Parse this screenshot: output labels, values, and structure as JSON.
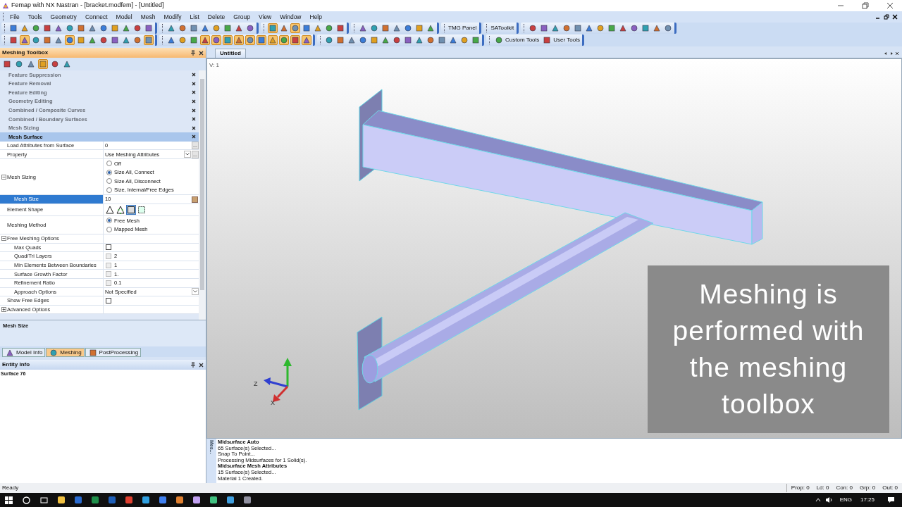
{
  "window": {
    "title": "Femap with NX Nastran - [bracket.modfem] - [Untitled]"
  },
  "menu": [
    "File",
    "Tools",
    "Geometry",
    "Connect",
    "Model",
    "Mesh",
    "Modify",
    "List",
    "Delete",
    "Group",
    "View",
    "Window",
    "Help"
  ],
  "toolbars": {
    "row_1_buttons": [
      "TMG Panel",
      "SAToolkit"
    ],
    "row_2_buttons": [
      "Custom Tools",
      "User Tools"
    ]
  },
  "toolbox": {
    "title": "Meshing Toolbox",
    "sections": [
      {
        "label": "Feature Suppression",
        "selected": false
      },
      {
        "label": "Feature Removal",
        "selected": false
      },
      {
        "label": "Feature Editing",
        "selected": false
      },
      {
        "label": "Geometry Editing",
        "selected": false
      },
      {
        "label": "Combined / Composite Curves",
        "selected": false
      },
      {
        "label": "Combined / Boundary Surfaces",
        "selected": false
      },
      {
        "label": "Mesh Sizing",
        "selected": false
      },
      {
        "label": "Mesh Surface",
        "selected": true
      }
    ],
    "properties": [
      {
        "kind": "field",
        "label": "Load Attributes from Surface",
        "value": "0",
        "dropdown": false,
        "button": "...",
        "selected": false
      },
      {
        "kind": "field",
        "label": "Property",
        "value": "Use Meshing Attributes",
        "dropdown": true,
        "button": "...",
        "selected": false
      },
      {
        "kind": "radio",
        "label": "Mesh Sizing",
        "expanded": true,
        "options": [
          {
            "label": "Off",
            "selected": false
          },
          {
            "label": "Size All, Connect",
            "selected": true
          },
          {
            "label": "Size All, Disconnect",
            "selected": false
          },
          {
            "label": "Size, Internal/Free Edges",
            "selected": false
          }
        ],
        "children": [
          {
            "kind": "field",
            "label": "Mesh Size",
            "value": "10",
            "dropdown": false,
            "selected": true
          }
        ]
      },
      {
        "kind": "shapes",
        "label": "Element Shape",
        "shapes": [
          {
            "kind": "tri",
            "selected": false
          },
          {
            "kind": "tri6",
            "selected": false
          },
          {
            "kind": "quad",
            "selected": true
          },
          {
            "kind": "quad8",
            "selected": false
          }
        ]
      },
      {
        "kind": "radio",
        "label": "Meshing Method",
        "options": [
          {
            "label": "Free Mesh",
            "selected": true
          },
          {
            "label": "Mapped Mesh",
            "selected": false
          }
        ]
      },
      {
        "kind": "group",
        "label": "Free Meshing Options",
        "expanded": true,
        "children": [
          {
            "kind": "checkbox",
            "label": "Max Quads",
            "checked": false
          },
          {
            "kind": "checkbox",
            "label": "Quad/Tri Layers",
            "checked": false,
            "value": "2"
          },
          {
            "kind": "checkbox",
            "label": "Min Elements Between Boundaries",
            "checked": false,
            "value": "1"
          },
          {
            "kind": "checkbox",
            "label": "Surface Growth Factor",
            "checked": false,
            "value": "1."
          },
          {
            "kind": "checkbox",
            "label": "Refinement Ratio",
            "checked": false,
            "value": "0.1"
          },
          {
            "kind": "field",
            "label": "Approach Options",
            "value": "Not Specified",
            "dropdown": true,
            "selected": false
          }
        ]
      },
      {
        "kind": "checkbox",
        "label": "Show Free Edges",
        "checked": false
      },
      {
        "kind": "group",
        "label": "Advanced Options",
        "expanded": false
      }
    ],
    "description": "Mesh Size"
  },
  "panel_tabs": [
    {
      "label": "Model Info",
      "selected": false
    },
    {
      "label": "Meshing",
      "selected": true
    },
    {
      "label": "PostProcessing",
      "selected": false
    }
  ],
  "entity_info": {
    "title": "Entity Info",
    "text": "Surface 76"
  },
  "viewport": {
    "tab": "Untitled",
    "view_label": "V: 1",
    "axis_labels": [
      "Z",
      "X"
    ],
    "caption": "Meshing is performed with the meshing toolbox"
  },
  "messages": {
    "tab": "Mes...",
    "lines": [
      {
        "text": "Midsurface Auto",
        "bold": true
      },
      {
        "text": "65 Surface(s) Selected...",
        "bold": false
      },
      {
        "text": "Snap To Point...",
        "bold": false
      },
      {
        "text": "Processing Midsurfaces for 1 Solid(s).",
        "bold": false
      },
      {
        "text": "Midsurface Mesh Attributes",
        "bold": true
      },
      {
        "text": "15 Surface(s) Selected...",
        "bold": false
      },
      {
        "text": "Material 1 Created.",
        "bold": false
      }
    ]
  },
  "status_bar": {
    "text": "Ready",
    "counters": [
      "Prop: 0",
      "Ld: 0",
      "Con: 0",
      "Grp: 0",
      "Out: 0"
    ]
  },
  "taskbar": {
    "language": "ENG",
    "time": "17:25"
  }
}
